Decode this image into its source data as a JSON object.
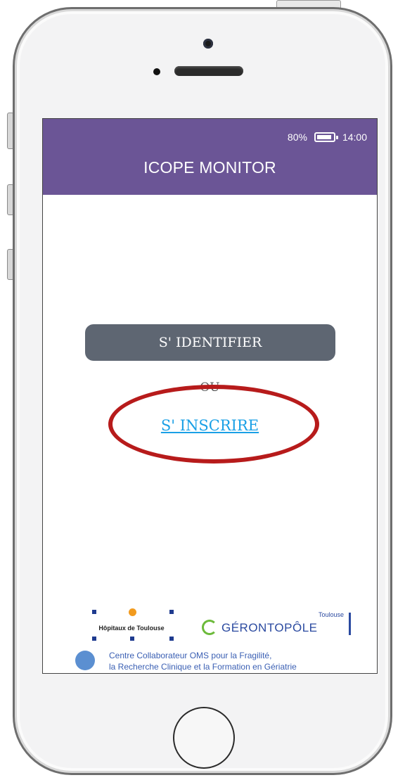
{
  "status_bar": {
    "battery_percent": "80%",
    "time": "14:00"
  },
  "app": {
    "title": "ICOPE MONITOR"
  },
  "actions": {
    "login_label": "S' IDENTIFIER",
    "or_label": "OU",
    "register_label": "S' INSCRIRE"
  },
  "footer": {
    "hopitaux_label": "Hôpitaux de Toulouse",
    "geronto_city": "Toulouse",
    "geronto_name": "GÉRONTOPÔLE",
    "who_line1": "Centre Collaborateur OMS pour la Fragilité,",
    "who_line2": "la Recherche Clinique et la Formation en Gériatrie"
  },
  "colors": {
    "appbar": "#6b5596",
    "button": "#5e6672",
    "link": "#1aa0e6",
    "highlight": "#b71b1b"
  }
}
